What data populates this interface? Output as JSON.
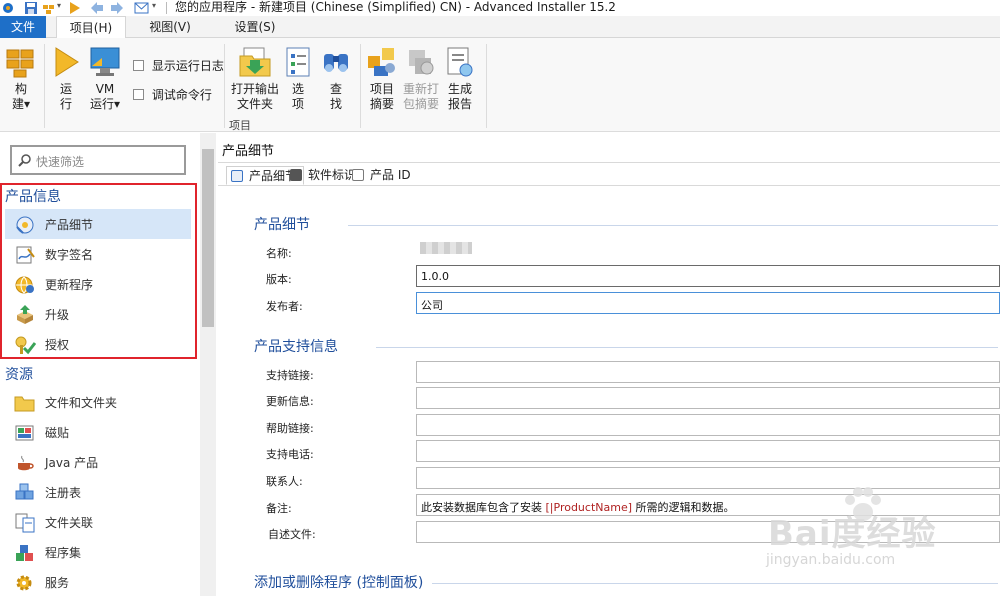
{
  "window": {
    "title": "您的应用程序 - 新建项目 (Chinese (Simplified) CN) - Advanced Installer 15.2"
  },
  "menu_tabs": {
    "file": "文件",
    "project": "项目(H)",
    "view": "视图(V)",
    "settings": "设置(S)"
  },
  "ribbon": {
    "build_line1": "构",
    "build_line2": "建▾",
    "run_line1": "运",
    "run_line2": "行",
    "vm_line1": "VM",
    "vm_line2": "运行▾",
    "show_log": "显示运行日志",
    "debug_cmd": "调试命令行",
    "open_output_line1": "打开输出",
    "open_output_line2": "文件夹",
    "options_line1": "选",
    "options_line2": "项",
    "find_line1": "查",
    "find_line2": "找",
    "summary_line1": "项目",
    "summary_line2": "摘要",
    "repack_line1": "重新打",
    "repack_line2": "包摘要",
    "report_line1": "生成",
    "report_line2": "报告",
    "group_project": "项目"
  },
  "sidebar": {
    "search_placeholder": "快速筛选",
    "sections": [
      {
        "title": "产品信息",
        "items": [
          {
            "label": "产品细节"
          },
          {
            "label": "数字签名"
          },
          {
            "label": "更新程序"
          },
          {
            "label": "升级"
          },
          {
            "label": "授权"
          }
        ]
      },
      {
        "title": "资源",
        "items": [
          {
            "label": "文件和文件夹"
          },
          {
            "label": "磁贴"
          },
          {
            "label": "Java 产品"
          },
          {
            "label": "注册表"
          },
          {
            "label": "文件关联"
          },
          {
            "label": "程序集"
          },
          {
            "label": "服务"
          }
        ]
      }
    ]
  },
  "main": {
    "header": "产品细节",
    "tabs": [
      {
        "label": "产品细节"
      },
      {
        "label": "软件标识"
      },
      {
        "label": "产品 ID"
      }
    ],
    "section1": {
      "title": "产品细节",
      "fields": [
        {
          "label": "名称:",
          "value": ""
        },
        {
          "label": "版本:",
          "value": "1.0.0"
        },
        {
          "label": "发布者:",
          "value": "公司"
        }
      ]
    },
    "section2": {
      "title": "产品支持信息",
      "fields": [
        {
          "label": "支持链接:",
          "value": ""
        },
        {
          "label": "更新信息:",
          "value": ""
        },
        {
          "label": "帮助链接:",
          "value": ""
        },
        {
          "label": "支持电话:",
          "value": ""
        },
        {
          "label": "联系人:",
          "value": ""
        },
        {
          "label": "备注:",
          "value_pre": "此安装数据库包含了安装 ",
          "value_token": "[|ProductName]",
          "value_post": " 所需的逻辑和数据。"
        },
        {
          "label": "自述文件:",
          "value": ""
        }
      ]
    },
    "section3": {
      "title": "添加或删除程序 (控制面板)"
    }
  },
  "watermark": {
    "text": "Bai度经验",
    "url": "jingyan.baidu.com"
  },
  "colors": {
    "accent": "#1e6fc8",
    "section_title": "#1f4e9b",
    "selection": "#d6e6f8",
    "highlight_box": "#e0242c"
  }
}
